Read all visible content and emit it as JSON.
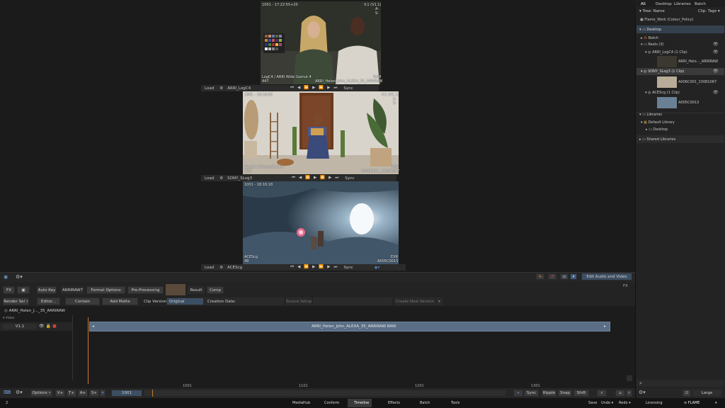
{
  "viewers": [
    {
      "tc_left": "1001 - 17:22:55+20",
      "tc_right": "V.1 (V1.1)",
      "corner": "A-\nS-",
      "caption_left": "LogC4 / ARRI Wide Gamut 4",
      "caption_left2": "447",
      "caption_right": "ARRI_Helen_John_ALEXA_35_ARRIRAW",
      "tag": "RAW",
      "load": "Load",
      "clip": "ARRI_LogC4",
      "sync": "Sync"
    },
    {
      "tc_left": "1001 - 18:16:05",
      "tc_right": "V.1 (V1.1)",
      "corner": "A-\nS-",
      "caption_left": "SLog3 / SGamut3.Cine",
      "caption_left2": "398",
      "caption_right": "A006C001_230810R7",
      "tag": "RAW",
      "load": "Load",
      "clip": "SONY_SLog3",
      "sync": "Sync"
    },
    {
      "tc_left": "1001 - 18:16:18",
      "tc_right": "",
      "corner": "",
      "caption_left": "ACEScg",
      "caption_left2": "48",
      "caption_right": "A005C0013",
      "tag": "EXR",
      "load": "Load",
      "clip": "ACEScg",
      "sync": "Sync"
    }
  ],
  "right_panel": {
    "tabs": [
      "All",
      "Desktop",
      "Libraries",
      "Batch"
    ],
    "tree_label": "Tree: Name",
    "clip_tags": "Clip: Tags",
    "tree": [
      {
        "label": "Flame_Work (Colour_Policy)"
      },
      {
        "label": "Desktop"
      },
      {
        "label": "Batch"
      },
      {
        "label": "Reels (3)"
      },
      {
        "label": "ARRI_LogC4 (1 Clip)"
      },
      {
        "label": "ARRI_Helo..._ARRIRAW"
      },
      {
        "label": "SONY_SLog3 (1 Clip)"
      },
      {
        "label": "A006C001_230810R7"
      },
      {
        "label": "ACEScg (1 Clip)"
      },
      {
        "label": "A005C0013"
      },
      {
        "label": "Libraries"
      },
      {
        "label": "Default Library"
      },
      {
        "label": "Desktop"
      },
      {
        "label": "Shared Libraries"
      }
    ],
    "size_label": "Large"
  },
  "toolbar_mid": {
    "edit_audio": "Edit Audio and Video",
    "fx": "FX"
  },
  "editor": {
    "fx": "FX",
    "auto_key": "Auto Key",
    "arriraw": "ARRIRAW7",
    "format_options": "Format Options",
    "pre_processing": "Pre-Processing",
    "result": "Result",
    "comp": "Comp",
    "render_sel": "Render Sel",
    "editor": "Editor...",
    "contain": "Contain",
    "add_matte": "Add Matte",
    "clip_versions": "Clip Versions",
    "original": "Original",
    "creation_date": "Creation Date:",
    "source_setup": "Source Setup",
    "create_new_version": "Create New Version"
  },
  "timeline": {
    "sequence": "ARRI_Helen_J..._35_ARRIRAW",
    "video_label": "Video",
    "track": "V1.1",
    "clip_name": "ARRI_Helen_John_ALEXA_35_ARRIRAW",
    "clip_tag": "RAW",
    "ticks": [
      "1001",
      "1101",
      "1201",
      "1301"
    ],
    "options": "Options",
    "frame": "1001",
    "v": "V+",
    "t": "T+",
    "a": "A+",
    "s": "S+",
    "sync": "Sync",
    "ripple": "Ripple",
    "snap": "Snap",
    "shift": "Shift"
  },
  "bottom_nav": {
    "items": [
      "MediaHub",
      "Conform",
      "Timeline",
      "Effects",
      "Batch",
      "Tools"
    ],
    "active": "Timeline",
    "left": "2",
    "save": "Save",
    "undo": "Undo",
    "redo": "Redo",
    "licensing": "Licensing",
    "brand": "FLAME"
  },
  "colors": {
    "accent": "#4a6c8e",
    "playhead": "#c87a2a",
    "clip": "#5a6f86"
  }
}
